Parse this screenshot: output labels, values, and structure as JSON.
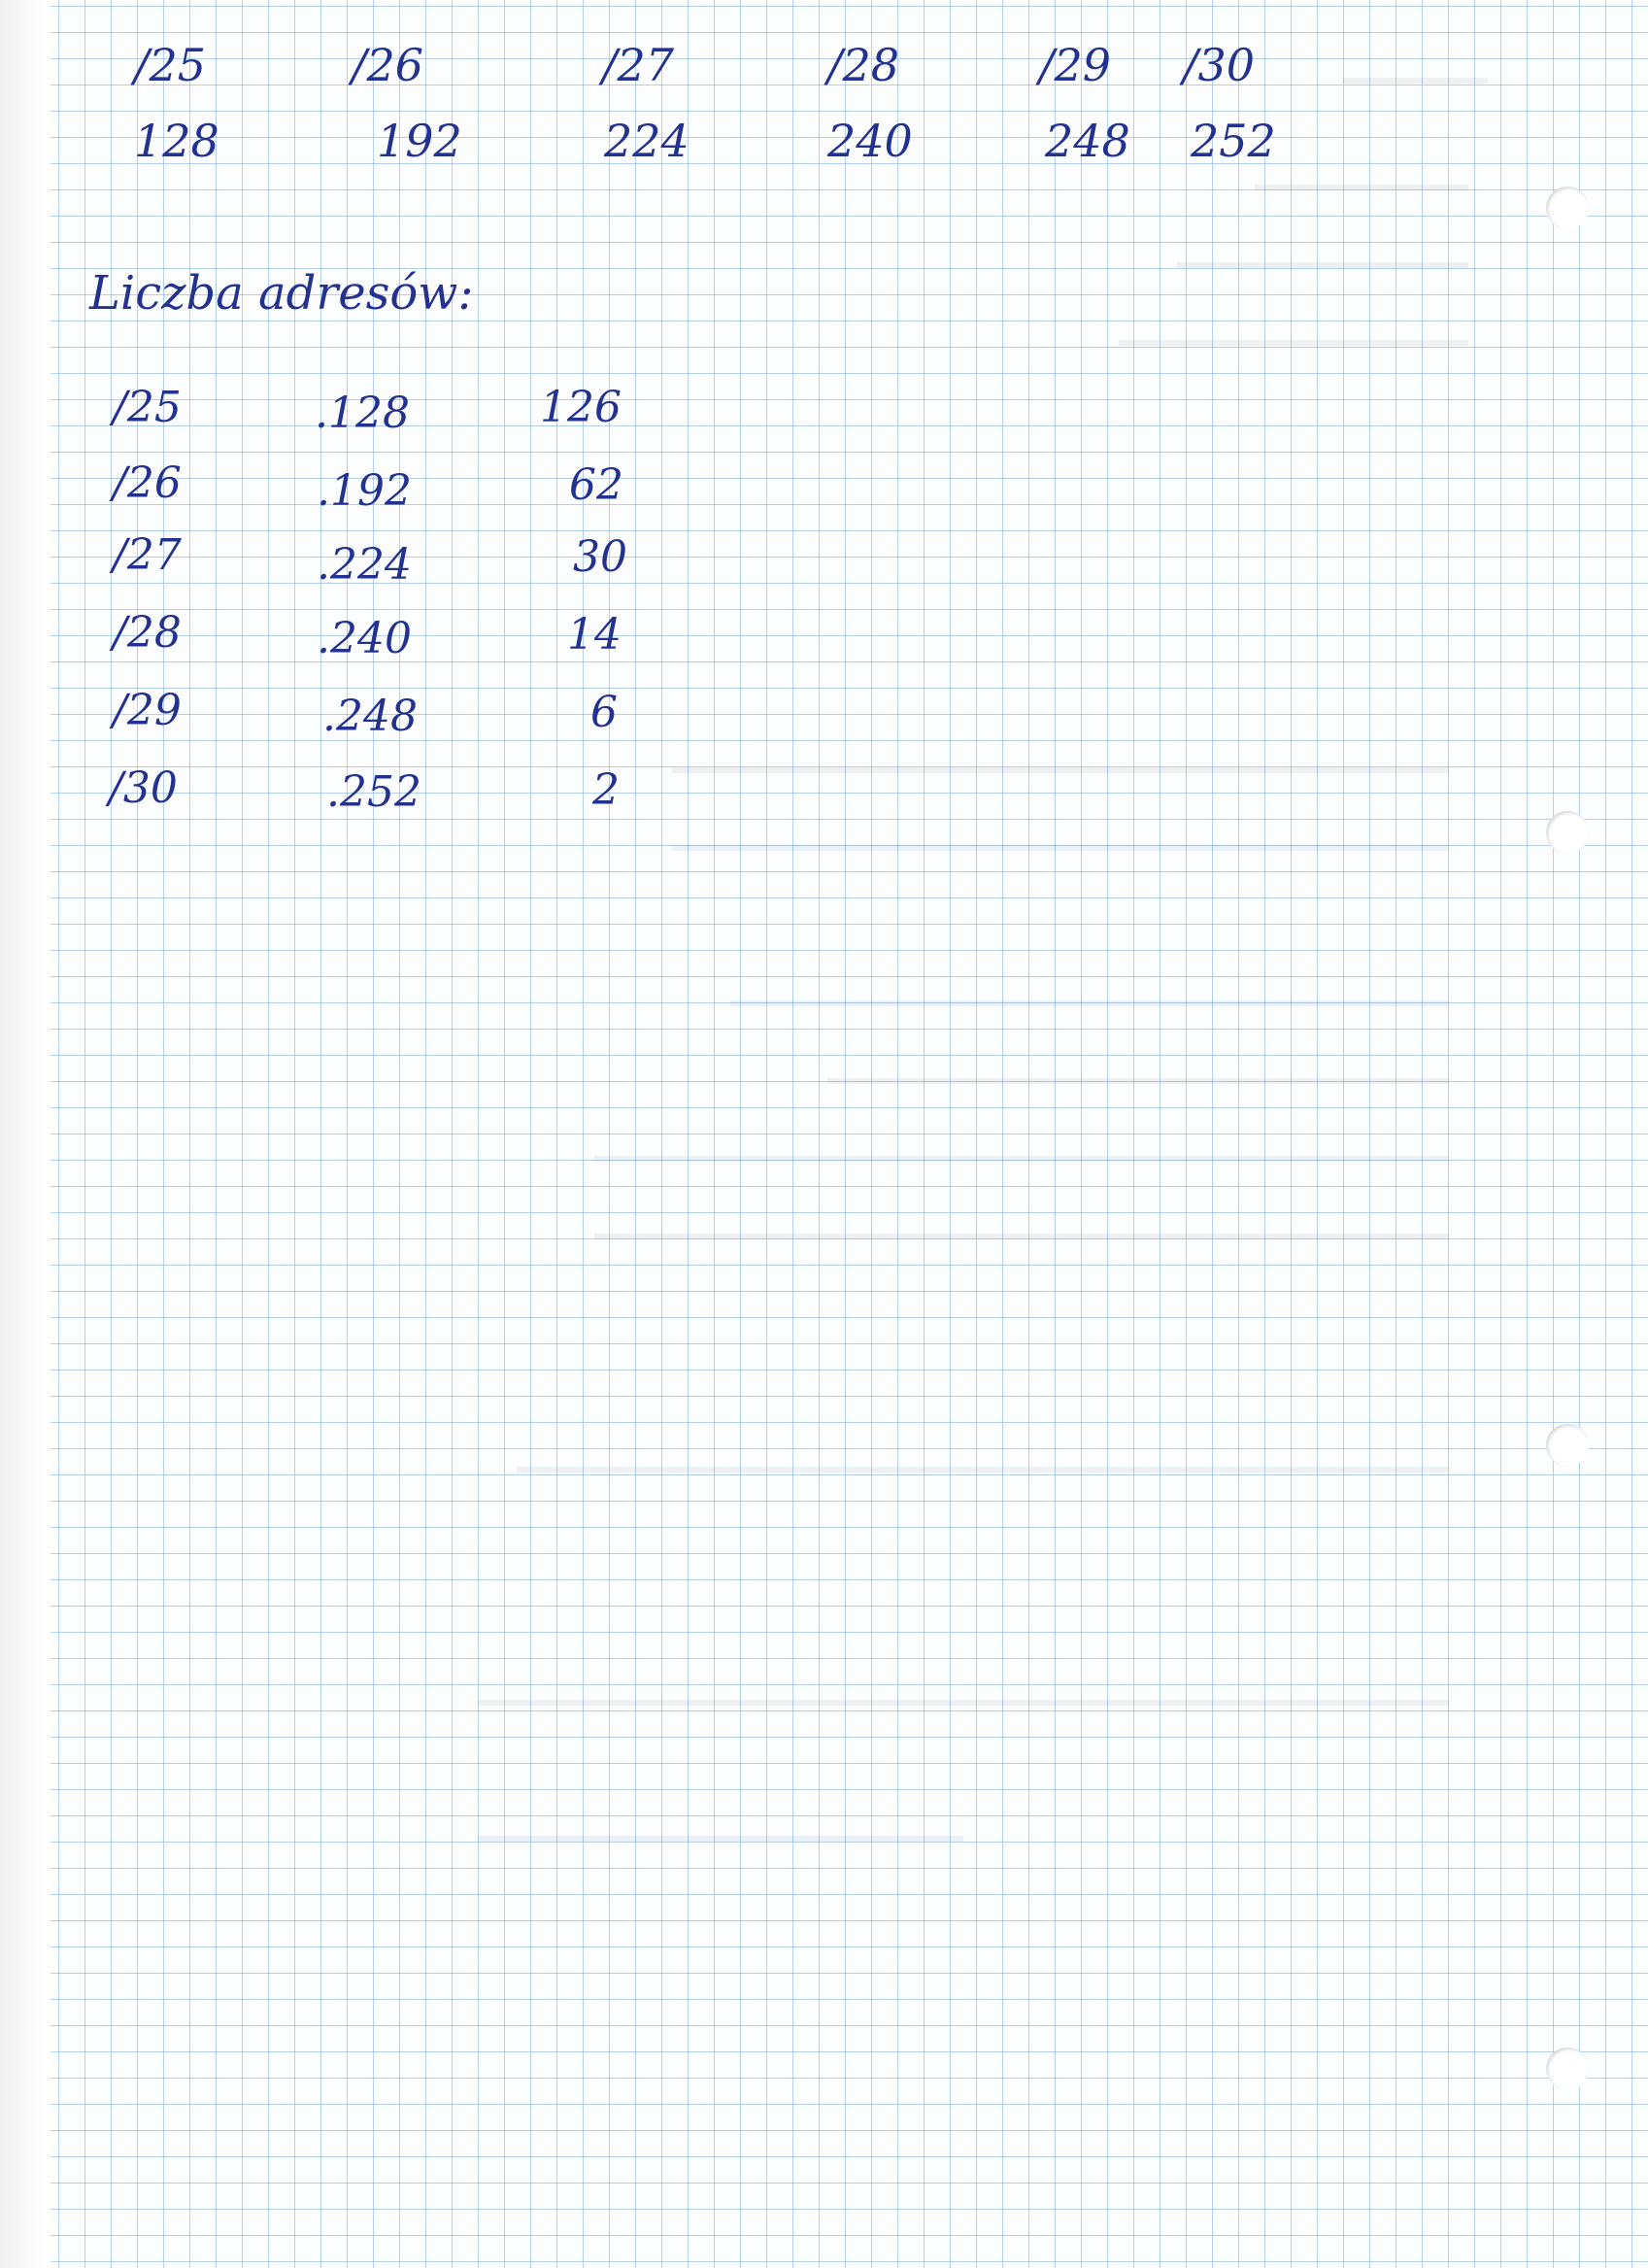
{
  "header_row": {
    "prefixes": [
      "/25",
      "/26",
      "/27",
      "/28",
      "/29",
      "/30"
    ],
    "masks": [
      "128",
      "192",
      "224",
      "240",
      "248",
      "252"
    ]
  },
  "heading": "Liczba adresów:",
  "rows": [
    {
      "prefix": "/25",
      "mask": ".128",
      "hosts": "126"
    },
    {
      "prefix": "/26",
      "mask": ".192",
      "hosts": "62"
    },
    {
      "prefix": "/27",
      "mask": ".224",
      "hosts": "30"
    },
    {
      "prefix": "/28",
      "mask": ".240",
      "hosts": "14"
    },
    {
      "prefix": "/29",
      "mask": ".248",
      "hosts": "6"
    },
    {
      "prefix": "/30",
      "mask": ".252",
      "hosts": "2"
    }
  ],
  "colors": {
    "ink": "#23328f",
    "grid": "#78aadc",
    "paper": "#fbfdff"
  }
}
